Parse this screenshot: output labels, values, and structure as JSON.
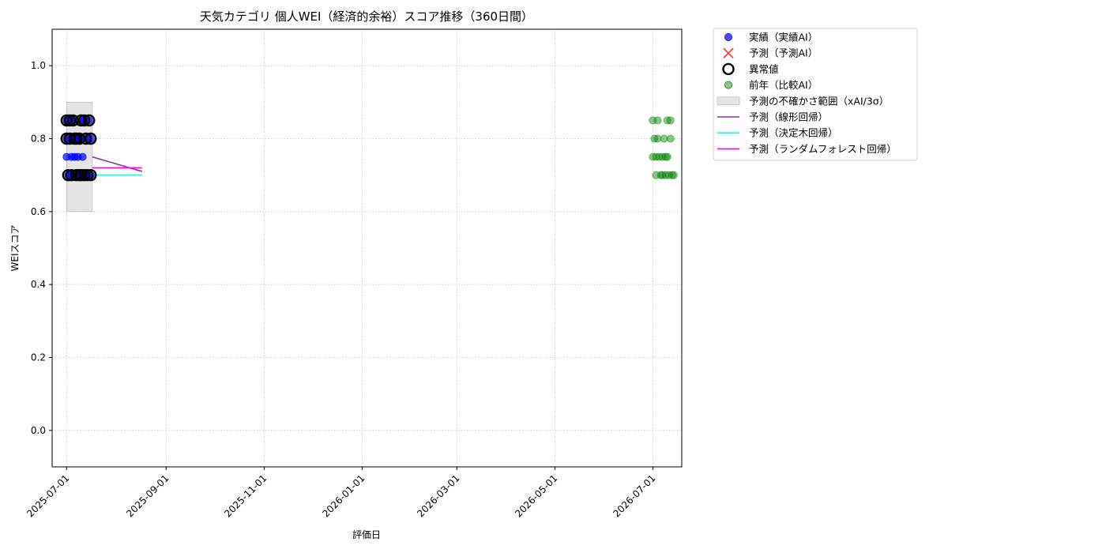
{
  "chart_data": {
    "type": "scatter",
    "title": "天気カテゴリ 個人WEI（経済的余裕）スコア推移（360日間）",
    "xlabel": "評価日",
    "ylabel": "WEIスコア",
    "x_type": "date",
    "xlim": [
      "2025-06-22",
      "2026-07-19"
    ],
    "ylim": [
      -0.1,
      1.1
    ],
    "yticks": [
      0.0,
      0.2,
      0.4,
      0.6,
      0.8,
      1.0
    ],
    "ytick_labels": [
      "0.0",
      "0.2",
      "0.4",
      "0.6",
      "0.8",
      "1.0"
    ],
    "xticks": [
      "2025-07-01",
      "2025-09-01",
      "2025-11-01",
      "2026-01-01",
      "2026-03-01",
      "2026-05-01",
      "2026-07-01"
    ],
    "grid": true,
    "legend_position": "outside-top-right",
    "series": [
      {
        "name": "実績（実績AI）",
        "kind": "scatter",
        "color": "#0000ff",
        "points": [
          {
            "x": "2025-07-01",
            "y": 0.85
          },
          {
            "x": "2025-07-01",
            "y": 0.8
          },
          {
            "x": "2025-07-01",
            "y": 0.75
          },
          {
            "x": "2025-07-02",
            "y": 0.7
          },
          {
            "x": "2025-07-03",
            "y": 0.85
          },
          {
            "x": "2025-07-03",
            "y": 0.8
          },
          {
            "x": "2025-07-04",
            "y": 0.75
          },
          {
            "x": "2025-07-04",
            "y": 0.7
          },
          {
            "x": "2025-07-05",
            "y": 0.85
          },
          {
            "x": "2025-07-06",
            "y": 0.8
          },
          {
            "x": "2025-07-06",
            "y": 0.75
          },
          {
            "x": "2025-07-07",
            "y": 0.7
          },
          {
            "x": "2025-07-07",
            "y": 0.8
          },
          {
            "x": "2025-07-08",
            "y": 0.75
          },
          {
            "x": "2025-07-09",
            "y": 0.7
          },
          {
            "x": "2025-07-09",
            "y": 0.8
          },
          {
            "x": "2025-07-10",
            "y": 0.85
          },
          {
            "x": "2025-07-10",
            "y": 0.7
          },
          {
            "x": "2025-07-11",
            "y": 0.75
          },
          {
            "x": "2025-07-12",
            "y": 0.7
          },
          {
            "x": "2025-07-12",
            "y": 0.85
          },
          {
            "x": "2025-07-13",
            "y": 0.8
          },
          {
            "x": "2025-07-14",
            "y": 0.7
          },
          {
            "x": "2025-07-15",
            "y": 0.85
          },
          {
            "x": "2025-07-16",
            "y": 0.8
          },
          {
            "x": "2025-07-16",
            "y": 0.7
          }
        ]
      },
      {
        "name": "予測（予測AI）",
        "kind": "scatter-x",
        "color": "#ff0000",
        "points": []
      },
      {
        "name": "異常値",
        "kind": "ring",
        "color": "#000000",
        "points": [
          {
            "x": "2025-07-01",
            "y": 0.85
          },
          {
            "x": "2025-07-01",
            "y": 0.8
          },
          {
            "x": "2025-07-02",
            "y": 0.7
          },
          {
            "x": "2025-07-03",
            "y": 0.85
          },
          {
            "x": "2025-07-03",
            "y": 0.8
          },
          {
            "x": "2025-07-04",
            "y": 0.7
          },
          {
            "x": "2025-07-05",
            "y": 0.85
          },
          {
            "x": "2025-07-06",
            "y": 0.8
          },
          {
            "x": "2025-07-07",
            "y": 0.7
          },
          {
            "x": "2025-07-07",
            "y": 0.8
          },
          {
            "x": "2025-07-09",
            "y": 0.7
          },
          {
            "x": "2025-07-09",
            "y": 0.8
          },
          {
            "x": "2025-07-10",
            "y": 0.85
          },
          {
            "x": "2025-07-10",
            "y": 0.7
          },
          {
            "x": "2025-07-12",
            "y": 0.7
          },
          {
            "x": "2025-07-12",
            "y": 0.85
          },
          {
            "x": "2025-07-13",
            "y": 0.8
          },
          {
            "x": "2025-07-14",
            "y": 0.7
          },
          {
            "x": "2025-07-15",
            "y": 0.85
          },
          {
            "x": "2025-07-16",
            "y": 0.8
          },
          {
            "x": "2025-07-16",
            "y": 0.7
          }
        ]
      },
      {
        "name": "前年（比較AI）",
        "kind": "scatter",
        "color": "#008000",
        "points": [
          {
            "x": "2026-07-01",
            "y": 0.85
          },
          {
            "x": "2026-07-01",
            "y": 0.75
          },
          {
            "x": "2026-07-02",
            "y": 0.8
          },
          {
            "x": "2026-07-03",
            "y": 0.7
          },
          {
            "x": "2026-07-03",
            "y": 0.75
          },
          {
            "x": "2026-07-04",
            "y": 0.85
          },
          {
            "x": "2026-07-04",
            "y": 0.8
          },
          {
            "x": "2026-07-05",
            "y": 0.75
          },
          {
            "x": "2026-07-06",
            "y": 0.7
          },
          {
            "x": "2026-07-07",
            "y": 0.7
          },
          {
            "x": "2026-07-07",
            "y": 0.75
          },
          {
            "x": "2026-07-08",
            "y": 0.8
          },
          {
            "x": "2026-07-09",
            "y": 0.75
          },
          {
            "x": "2026-07-09",
            "y": 0.7
          },
          {
            "x": "2026-07-10",
            "y": 0.85
          },
          {
            "x": "2026-07-10",
            "y": 0.75
          },
          {
            "x": "2026-07-11",
            "y": 0.7
          },
          {
            "x": "2026-07-12",
            "y": 0.85
          },
          {
            "x": "2026-07-12",
            "y": 0.8
          },
          {
            "x": "2026-07-13",
            "y": 0.7
          },
          {
            "x": "2026-07-14",
            "y": 0.7
          }
        ]
      },
      {
        "name": "予測の不確かさ範囲（xAI/3σ）",
        "kind": "band",
        "color": "#cccccc",
        "x_from": "2025-07-01",
        "x_to": "2025-07-17",
        "y_from": 0.6,
        "y_to": 0.9
      },
      {
        "name": "予測（線形回帰）",
        "kind": "line",
        "color": "#9c27b0",
        "points": [
          {
            "x": "2025-07-17",
            "y": 0.75
          },
          {
            "x": "2025-08-17",
            "y": 0.71
          }
        ]
      },
      {
        "name": "予測（決定木回帰）",
        "kind": "line",
        "color": "#00ffff",
        "points": [
          {
            "x": "2025-07-17",
            "y": 0.7
          },
          {
            "x": "2025-08-17",
            "y": 0.7
          }
        ]
      },
      {
        "name": "予測（ランダムフォレスト回帰）",
        "kind": "line",
        "color": "#ff00ff",
        "points": [
          {
            "x": "2025-07-17",
            "y": 0.72
          },
          {
            "x": "2025-08-17",
            "y": 0.72
          }
        ]
      }
    ]
  }
}
